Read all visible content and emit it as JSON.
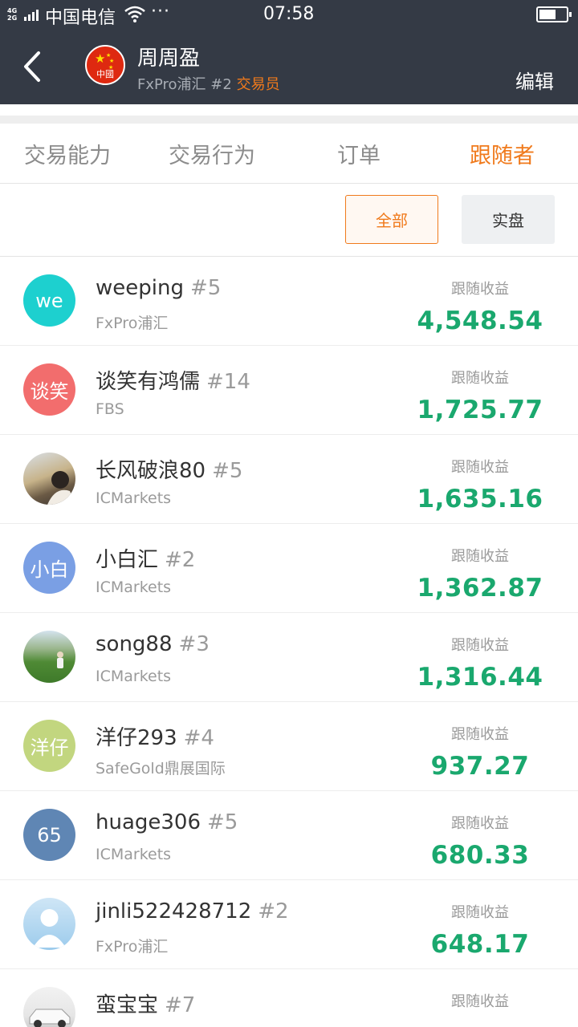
{
  "status_bar": {
    "network": "4G\n2G",
    "carrier": "中国电信",
    "time": "07:58",
    "more": "···"
  },
  "header": {
    "name": "周周盈",
    "flag_text": "中國",
    "broker": "FxPro浦汇",
    "rank": "#2",
    "role": "交易员",
    "edit_label": "编辑"
  },
  "tabs": [
    {
      "label": "交易能力"
    },
    {
      "label": "交易行为"
    },
    {
      "label": "订单"
    },
    {
      "label": "跟随者"
    }
  ],
  "filters": {
    "all_label": "全部",
    "real_label": "实盘"
  },
  "followers": [
    {
      "avatar_text": "we",
      "avatar_color": "#1dd0cf",
      "name": "weeping",
      "rank": "#5",
      "broker": "FxPro浦汇",
      "profit_label": "跟随收益",
      "profit": "4,548.54"
    },
    {
      "avatar_text": "谈笑",
      "avatar_color": "#f26d6d",
      "name": "谈笑有鸿儒",
      "rank": "#14",
      "broker": "FBS",
      "profit_label": "跟随收益",
      "profit": "1,725.77"
    },
    {
      "avatar_text": "",
      "avatar_photo": "landscape",
      "name": "长风破浪80",
      "rank": "#5",
      "broker": "ICMarkets",
      "profit_label": "跟随收益",
      "profit": "1,635.16"
    },
    {
      "avatar_text": "小白",
      "avatar_color": "#7a9fe4",
      "name": "小白汇",
      "rank": "#2",
      "broker": "ICMarkets",
      "profit_label": "跟随收益",
      "profit": "1,362.87"
    },
    {
      "avatar_text": "",
      "avatar_photo": "field",
      "name": "song88",
      "rank": "#3",
      "broker": "ICMarkets",
      "profit_label": "跟随收益",
      "profit": "1,316.44"
    },
    {
      "avatar_text": "洋仔",
      "avatar_color": "#c2d67f",
      "name": "洋仔293",
      "rank": "#4",
      "broker": "SafeGold鼎展国际",
      "profit_label": "跟随收益",
      "profit": "937.27"
    },
    {
      "avatar_text": "65",
      "avatar_color": "#5f86b4",
      "name": "huage306",
      "rank": "#5",
      "broker": "ICMarkets",
      "profit_label": "跟随收益",
      "profit": "680.33"
    },
    {
      "avatar_text": "",
      "avatar_photo": "person",
      "name": "jinli522428712",
      "rank": "#2",
      "broker": "FxPro浦汇",
      "profit_label": "跟随收益",
      "profit": "648.17"
    },
    {
      "avatar_text": "",
      "avatar_photo": "car",
      "name": "蛮宝宝",
      "rank": "#7",
      "broker": "",
      "profit_label": "跟随收益",
      "profit": ""
    }
  ]
}
